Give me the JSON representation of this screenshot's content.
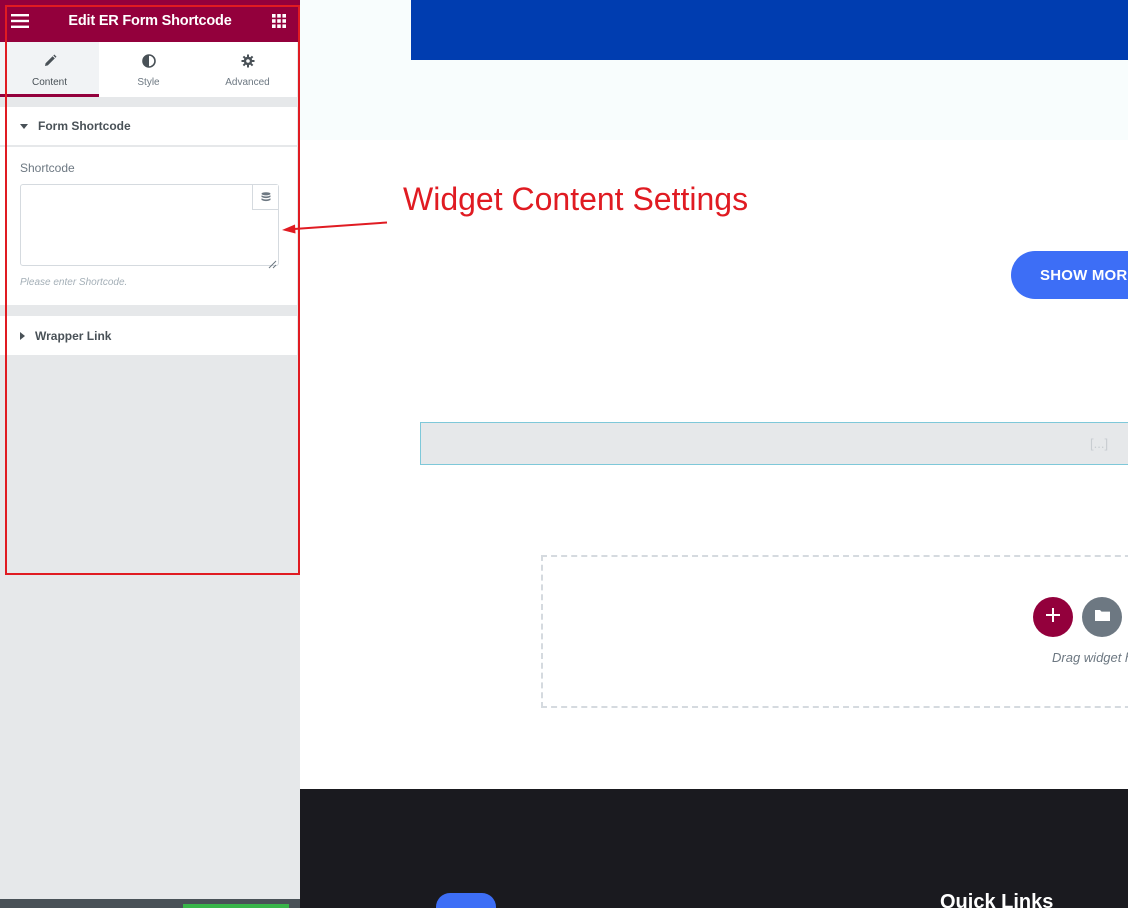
{
  "panel": {
    "header_title": "Edit ER Form Shortcode",
    "tabs": [
      {
        "label": "Content",
        "icon": "pencil-icon",
        "active": true
      },
      {
        "label": "Style",
        "icon": "half-circle-icon",
        "active": false
      },
      {
        "label": "Advanced",
        "icon": "gear-icon",
        "active": false
      }
    ],
    "sections": {
      "form_shortcode": {
        "title": "Form Shortcode",
        "control_label": "Shortcode",
        "value": "",
        "hint": "Please enter Shortcode."
      },
      "wrapper_link": {
        "title": "Wrapper Link"
      }
    }
  },
  "preview": {
    "annotation": "Widget Content Settings",
    "show_more_label": "SHOW MOR",
    "shortcode_placeholder": "[...]",
    "drag_text": "Drag widget h",
    "footer_heading": "Quick Links"
  },
  "colors": {
    "brand": "#93003c",
    "annotation_red": "#e01b22",
    "button_blue": "#3d6ef6",
    "banner_blue": "#003db0",
    "footer_dark": "#1a1a1f"
  }
}
